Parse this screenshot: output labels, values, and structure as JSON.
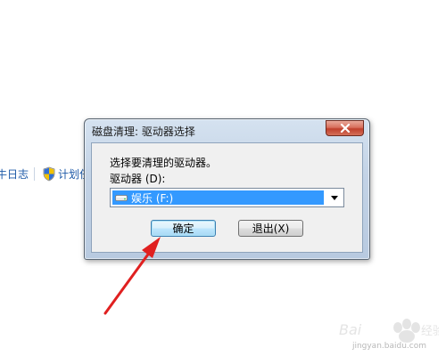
{
  "background": {
    "link_1": "牛日志",
    "link_2": "计划任务"
  },
  "dialog": {
    "title": "磁盘清理: 驱动器选择",
    "prompt": "选择要清理的驱动器。",
    "drive_label": "驱动器 (D):",
    "drive_selected": "娱乐 (F:)",
    "ok_label": "确定",
    "exit_label": "退出(X)"
  },
  "colors": {
    "selection": "#3399ff",
    "link": "#1e5aa8",
    "arrow": "#e02020",
    "close_button": "#c0402c"
  },
  "icons": {
    "close": "close-icon",
    "drive": "drive-icon",
    "dropdown": "chevron-down-icon",
    "shield": "shield-icon"
  },
  "watermark": {
    "brand": "Bai 经验",
    "url": "jingyan.baidu.com"
  }
}
